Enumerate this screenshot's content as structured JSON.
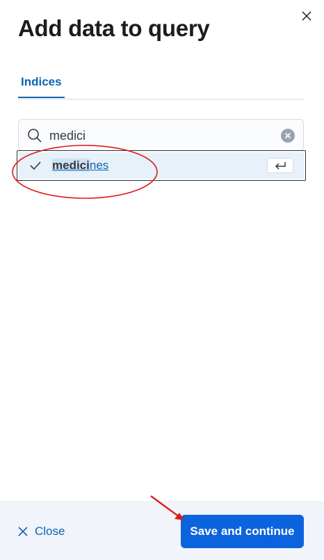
{
  "flyout": {
    "title": "Add data to query",
    "close_icon": "close-icon"
  },
  "tabs": [
    {
      "label": "Indices",
      "selected": true
    }
  ],
  "search": {
    "value": "medici",
    "search_icon": "search-icon",
    "clear_icon": "clear-icon"
  },
  "results": [
    {
      "match": "medici",
      "rest": "nes",
      "checked": true,
      "enter_icon": "enter-key-icon"
    }
  ],
  "footer": {
    "close_label": "Close",
    "save_label": "Save and continue"
  },
  "annotation_color": "#e0191a",
  "accent_color": "#0b64dd"
}
